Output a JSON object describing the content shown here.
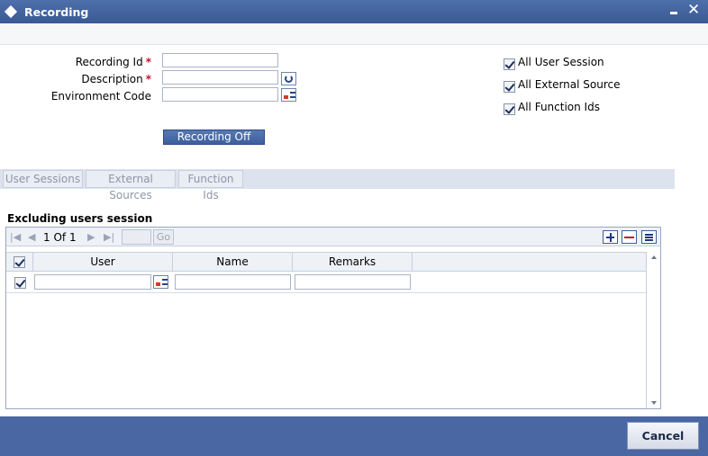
{
  "window": {
    "title": "Recording"
  },
  "form": {
    "recording_id_label": "Recording Id",
    "description_label": "Description",
    "environment_code_label": "Environment Code",
    "required_mark": "*",
    "recording_id_value": "",
    "description_value": "",
    "environment_code_value": "",
    "recording_button": "Recording Off"
  },
  "options": {
    "all_user_session": {
      "label": "All User Session",
      "checked": true
    },
    "all_external_source": {
      "label": "All External Source",
      "checked": true
    },
    "all_function_ids": {
      "label": "All Function Ids",
      "checked": true
    }
  },
  "tabs": [
    {
      "label": "User Sessions"
    },
    {
      "label": "External Sources"
    },
    {
      "label": "Function Ids"
    }
  ],
  "section": {
    "title": "Excluding users session"
  },
  "grid": {
    "pager": {
      "current": "1",
      "of_label": "Of",
      "total": "1",
      "go_label": "Go"
    },
    "columns": [
      "User",
      "Name",
      "Remarks"
    ],
    "rows": [
      {
        "checked": true,
        "user": "",
        "name": "",
        "remarks": ""
      }
    ]
  },
  "footer": {
    "cancel_label": "Cancel"
  },
  "colors": {
    "titlebar": "#3a5995",
    "footer": "#4a66a3",
    "required": "#c8102e"
  }
}
